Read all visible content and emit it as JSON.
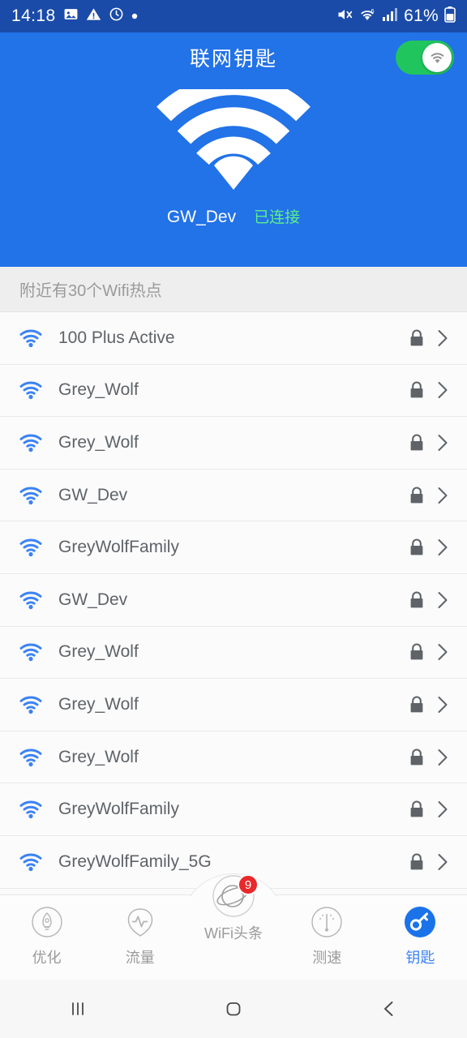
{
  "statusbar": {
    "time": "14:18",
    "battery_percent": "61%",
    "icons": [
      "image-icon",
      "warning-icon",
      "alarm-icon",
      "dot-icon",
      "mute-icon",
      "wifi-6-icon",
      "signal-bars-icon",
      "battery-icon"
    ]
  },
  "header": {
    "title": "联网钥匙",
    "toggle_on": true,
    "toggle_icon": "wifi-icon",
    "hero_icon": "wifi-large-icon",
    "connected_ssid": "GW_Dev",
    "connected_status": "已连接"
  },
  "section": {
    "label": "附近有30个Wifi热点"
  },
  "networks": [
    {
      "name": "100 Plus Active",
      "secured": true
    },
    {
      "name": "Grey_Wolf",
      "secured": true
    },
    {
      "name": "Grey_Wolf",
      "secured": true
    },
    {
      "name": "GW_Dev",
      "secured": true
    },
    {
      "name": "GreyWolfFamily",
      "secured": true
    },
    {
      "name": "GW_Dev",
      "secured": true
    },
    {
      "name": "Grey_Wolf",
      "secured": true
    },
    {
      "name": "Grey_Wolf",
      "secured": true
    },
    {
      "name": "Grey_Wolf",
      "secured": true
    },
    {
      "name": "GreyWolfFamily",
      "secured": true
    },
    {
      "name": "GreyWolfFamily_5G",
      "secured": true
    }
  ],
  "tabs": [
    {
      "label": "优化",
      "icon": "rocket-icon",
      "active": false
    },
    {
      "label": "流量",
      "icon": "pulse-icon",
      "active": false
    },
    {
      "label": "WiFi头条",
      "icon": "planet-icon",
      "active": false,
      "badge": "9"
    },
    {
      "label": "测速",
      "icon": "gauge-icon",
      "active": false
    },
    {
      "label": "钥匙",
      "icon": "key-icon",
      "active": true
    }
  ],
  "navbar": {
    "recents": "recents-icon",
    "home": "home-icon",
    "back": "back-icon"
  },
  "colors": {
    "brand_blue": "#2272e8",
    "status_blue": "#1a4ba8",
    "toggle_green": "#21c55d",
    "connected_green": "#5df08a",
    "accent_blue": "#3b82f6",
    "badge_red": "#e8282a"
  }
}
